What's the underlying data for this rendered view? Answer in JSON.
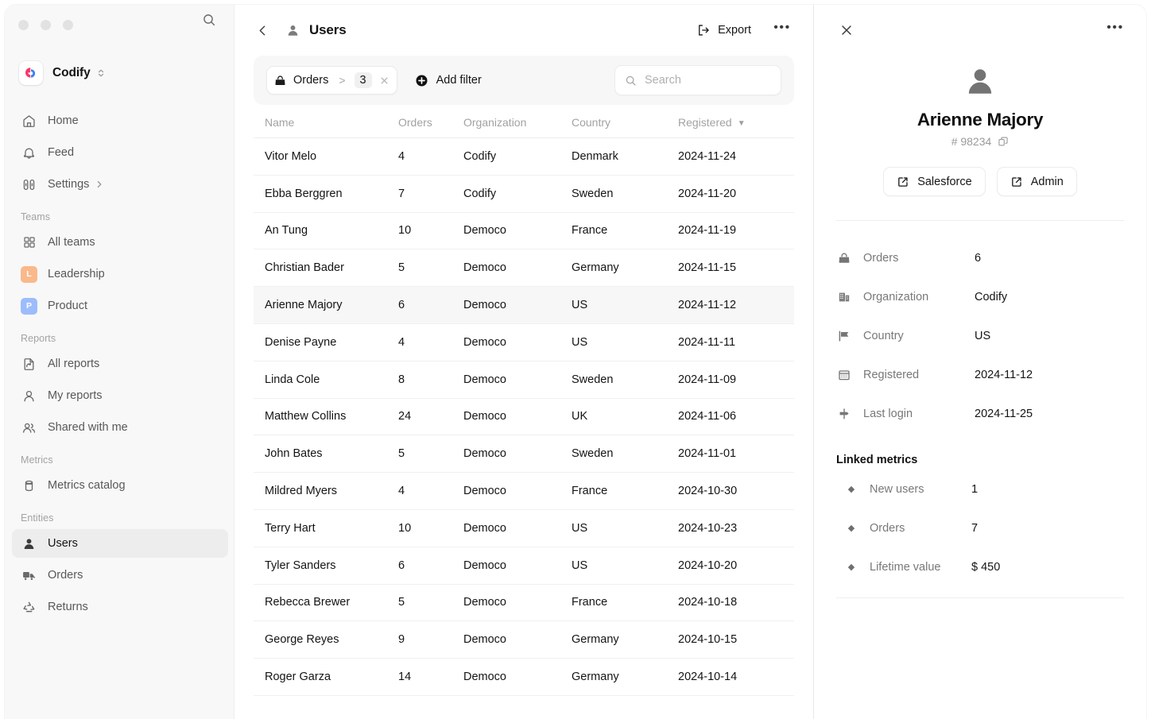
{
  "window": {
    "traffic_lights": [
      "close",
      "minimize",
      "maximize"
    ]
  },
  "sidebar": {
    "brand": {
      "name": "Codify",
      "logo_icon": "codify-logo",
      "switcher_icon": "chevron-updown-icon",
      "search_icon": "search-icon"
    },
    "nav": [
      {
        "label": "Home",
        "icon": "home-icon",
        "type": "item"
      },
      {
        "label": "Feed",
        "icon": "bell-icon",
        "type": "item"
      },
      {
        "label": "Settings",
        "icon": "sliders-icon",
        "type": "item",
        "chevron": "chevron-right-icon"
      }
    ],
    "sections": [
      {
        "title": "Teams",
        "items": [
          {
            "label": "All teams",
            "icon": "grid-icon",
            "kind": "icon"
          },
          {
            "label": "Leadership",
            "kind": "badge",
            "badge_letter": "L",
            "badge_color": "#f9b98a"
          },
          {
            "label": "Product",
            "kind": "badge",
            "badge_letter": "P",
            "badge_color": "#9dbcfb"
          }
        ]
      },
      {
        "title": "Reports",
        "items": [
          {
            "label": "All reports",
            "icon": "file-report-icon",
            "kind": "icon"
          },
          {
            "label": "My reports",
            "icon": "user-icon",
            "kind": "icon"
          },
          {
            "label": "Shared with me",
            "icon": "users-icon",
            "kind": "icon"
          }
        ]
      },
      {
        "title": "Metrics",
        "items": [
          {
            "label": "Metrics catalog",
            "icon": "cylinder-icon",
            "kind": "icon"
          }
        ]
      },
      {
        "title": "Entities",
        "items": [
          {
            "label": "Users",
            "icon": "person-filled-icon",
            "kind": "icon",
            "active": true
          },
          {
            "label": "Orders",
            "icon": "truck-icon",
            "kind": "icon"
          },
          {
            "label": "Returns",
            "icon": "recycle-icon",
            "kind": "icon"
          }
        ]
      }
    ]
  },
  "main": {
    "back_icon": "chevron-left-icon",
    "title_icon": "person-filled-icon",
    "title": "Users",
    "export_label": "Export",
    "export_icon": "export-icon",
    "more_icon": "more-horizontal-icon",
    "filter": {
      "pill": {
        "icon": "bag-icon",
        "field": "Orders",
        "operator": ">",
        "value": "3",
        "remove_icon": "close-small-icon"
      },
      "add_filter_label": "Add filter",
      "add_filter_icon": "plus-circle-icon",
      "search_placeholder": "Search",
      "search_value": "",
      "search_icon": "search-icon"
    },
    "table": {
      "columns": [
        "Name",
        "Orders",
        "Organization",
        "Country",
        "Registered"
      ],
      "sorted_column": "Registered",
      "sort_caret": "▼",
      "rows": [
        {
          "name": "Vitor Melo",
          "orders": "4",
          "organization": "Codify",
          "country": "Denmark",
          "registered": "2024-11-24",
          "selected": false
        },
        {
          "name": "Ebba Berggren",
          "orders": "7",
          "organization": "Codify",
          "country": "Sweden",
          "registered": "2024-11-20",
          "selected": false
        },
        {
          "name": "An Tung",
          "orders": "10",
          "organization": "Democo",
          "country": "France",
          "registered": "2024-11-19",
          "selected": false
        },
        {
          "name": "Christian Bader",
          "orders": "5",
          "organization": "Democo",
          "country": "Germany",
          "registered": "2024-11-15",
          "selected": false
        },
        {
          "name": "Arienne Majory",
          "orders": "6",
          "organization": "Democo",
          "country": "US",
          "registered": "2024-11-12",
          "selected": true
        },
        {
          "name": "Denise Payne",
          "orders": "4",
          "organization": "Democo",
          "country": "US",
          "registered": "2024-11-11",
          "selected": false
        },
        {
          "name": "Linda Cole",
          "orders": "8",
          "organization": "Democo",
          "country": "Sweden",
          "registered": "2024-11-09",
          "selected": false
        },
        {
          "name": "Matthew Collins",
          "orders": "24",
          "organization": "Democo",
          "country": "UK",
          "registered": "2024-11-06",
          "selected": false
        },
        {
          "name": "John Bates",
          "orders": "5",
          "organization": "Democo",
          "country": "Sweden",
          "registered": "2024-11-01",
          "selected": false
        },
        {
          "name": "Mildred Myers",
          "orders": "4",
          "organization": "Democo",
          "country": "France",
          "registered": "2024-10-30",
          "selected": false
        },
        {
          "name": "Terry Hart",
          "orders": "10",
          "organization": "Democo",
          "country": "US",
          "registered": "2024-10-23",
          "selected": false
        },
        {
          "name": "Tyler Sanders",
          "orders": "6",
          "organization": "Democo",
          "country": "US",
          "registered": "2024-10-20",
          "selected": false
        },
        {
          "name": "Rebecca Brewer",
          "orders": "5",
          "organization": "Democo",
          "country": "France",
          "registered": "2024-10-18",
          "selected": false
        },
        {
          "name": "George Reyes",
          "orders": "9",
          "organization": "Democo",
          "country": "Germany",
          "registered": "2024-10-15",
          "selected": false
        },
        {
          "name": "Roger Garza",
          "orders": "14",
          "organization": "Democo",
          "country": "Germany",
          "registered": "2024-10-14",
          "selected": false
        }
      ]
    }
  },
  "detail": {
    "close_icon": "close-icon",
    "more_icon": "more-horizontal-icon",
    "avatar_icon": "person-filled-icon",
    "name": "Arienne Majory",
    "id": "# 98234",
    "copy_icon": "copy-icon",
    "actions": [
      {
        "label": "Salesforce",
        "icon": "external-link-icon"
      },
      {
        "label": "Admin",
        "icon": "external-link-icon"
      }
    ],
    "fields": [
      {
        "label": "Orders",
        "value": "6",
        "icon": "bag-icon"
      },
      {
        "label": "Organization",
        "value": "Codify",
        "icon": "building-icon"
      },
      {
        "label": "Country",
        "value": "US",
        "icon": "flag-icon"
      },
      {
        "label": "Registered",
        "value": "2024-11-12",
        "icon": "calendar-icon"
      },
      {
        "label": "Last login",
        "value": "2024-11-25",
        "icon": "signpost-icon"
      }
    ],
    "metrics_title": "Linked metrics",
    "metrics": [
      {
        "label": "New users",
        "value": "1",
        "icon": "diamond-icon"
      },
      {
        "label": "Orders",
        "value": "7",
        "icon": "diamond-icon"
      },
      {
        "label": "Lifetime value",
        "value": "$ 450",
        "icon": "diamond-icon"
      }
    ]
  },
  "colors": {
    "sidebar_bg": "#f8f8f8",
    "content_bg": "#ffffff",
    "selected_row": "#f7f7f7",
    "active_nav": "#ededed",
    "brand_pink": "#f8356c",
    "brand_blue": "#3b82f6",
    "team_leadership": "#f9b98a",
    "team_product": "#9dbcfb"
  }
}
